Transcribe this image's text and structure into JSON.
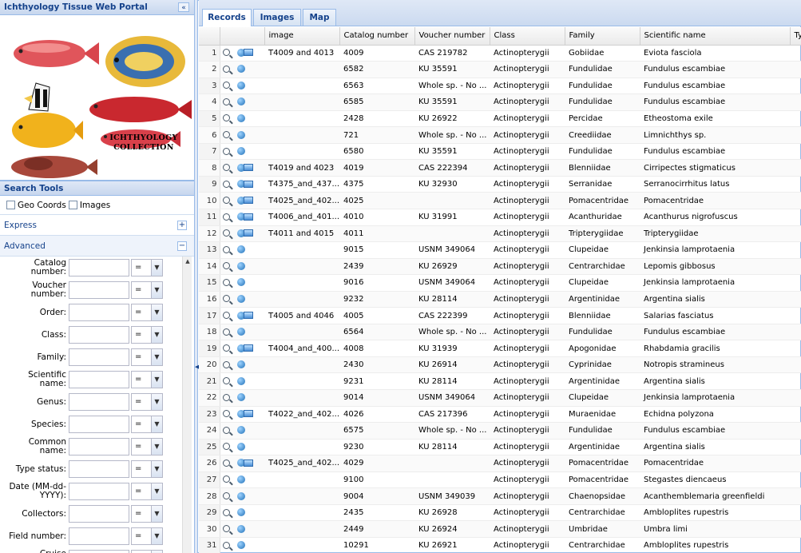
{
  "portal": {
    "title": "Ichthyology Tissue Web Portal",
    "collapse_icon": "«"
  },
  "collage": {
    "label_line1": "ICHTHYOLOGY",
    "label_line2": "COLLECTION"
  },
  "search_tools": {
    "title": "Search Tools",
    "checkboxes": [
      "Geo Coords",
      "Images"
    ],
    "express_label": "Express",
    "advanced_label": "Advanced",
    "express_toggle": "+",
    "advanced_toggle": "−",
    "fields": [
      {
        "label": "Catalog number:",
        "op": "="
      },
      {
        "label": "Voucher number:",
        "op": "="
      },
      {
        "label": "Order:",
        "op": "="
      },
      {
        "label": "Class:",
        "op": "="
      },
      {
        "label": "Family:",
        "op": "="
      },
      {
        "label": "Scientific name:",
        "op": "="
      },
      {
        "label": "Genus:",
        "op": "="
      },
      {
        "label": "Species:",
        "op": "="
      },
      {
        "label": "Common name:",
        "op": "="
      },
      {
        "label": "Type status:",
        "op": "="
      },
      {
        "label": "Date (MM-dd-YYYY):",
        "op": "="
      },
      {
        "label": "Collectors:",
        "op": "="
      },
      {
        "label": "Field number:",
        "op": "="
      },
      {
        "label": "Cruise information:",
        "op": "="
      }
    ]
  },
  "tabs": [
    "Records",
    "Images",
    "Map"
  ],
  "grid": {
    "columns": [
      "image",
      "Catalog number",
      "Voucher number",
      "Class",
      "Family",
      "Scientific name",
      "Typ"
    ],
    "rows": [
      {
        "n": "1",
        "img": true,
        "image": "T4009 and 4013",
        "cat": "4009",
        "vou": "CAS 219782",
        "cls": "Actinopterygii",
        "fam": "Gobiidae",
        "sci": "Eviota fasciola"
      },
      {
        "n": "2",
        "img": false,
        "image": "",
        "cat": "6582",
        "vou": "KU 35591",
        "cls": "Actinopterygii",
        "fam": "Fundulidae",
        "sci": "Fundulus escambiae"
      },
      {
        "n": "3",
        "img": false,
        "image": "",
        "cat": "6563",
        "vou": "Whole sp. - No ...",
        "cls": "Actinopterygii",
        "fam": "Fundulidae",
        "sci": "Fundulus escambiae"
      },
      {
        "n": "4",
        "img": false,
        "image": "",
        "cat": "6585",
        "vou": "KU 35591",
        "cls": "Actinopterygii",
        "fam": "Fundulidae",
        "sci": "Fundulus escambiae"
      },
      {
        "n": "5",
        "img": false,
        "image": "",
        "cat": "2428",
        "vou": "KU 26922",
        "cls": "Actinopterygii",
        "fam": "Percidae",
        "sci": "Etheostoma exile"
      },
      {
        "n": "6",
        "img": false,
        "image": "",
        "cat": "721",
        "vou": "Whole sp. - No ...",
        "cls": "Actinopterygii",
        "fam": "Creediidae",
        "sci": "Limnichthys sp."
      },
      {
        "n": "7",
        "img": false,
        "image": "",
        "cat": "6580",
        "vou": "KU 35591",
        "cls": "Actinopterygii",
        "fam": "Fundulidae",
        "sci": "Fundulus escambiae"
      },
      {
        "n": "8",
        "img": true,
        "image": "T4019 and 4023",
        "cat": "4019",
        "vou": "CAS 222394",
        "cls": "Actinopterygii",
        "fam": "Blenniidae",
        "sci": "Cirripectes stigmaticus"
      },
      {
        "n": "9",
        "img": true,
        "image": "T4375_and_437...",
        "cat": "4375",
        "vou": "KU 32930",
        "cls": "Actinopterygii",
        "fam": "Serranidae",
        "sci": "Serranocirrhitus latus"
      },
      {
        "n": "10",
        "img": true,
        "image": "T4025_and_402...",
        "cat": "4025",
        "vou": "",
        "cls": "Actinopterygii",
        "fam": "Pomacentridae",
        "sci": "Pomacentridae"
      },
      {
        "n": "11",
        "img": true,
        "image": "T4006_and_401...",
        "cat": "4010",
        "vou": "KU 31991",
        "cls": "Actinopterygii",
        "fam": "Acanthuridae",
        "sci": "Acanthurus nigrofuscus"
      },
      {
        "n": "12",
        "img": true,
        "image": "T4011 and 4015",
        "cat": "4011",
        "vou": "",
        "cls": "Actinopterygii",
        "fam": "Tripterygiidae",
        "sci": "Tripterygiidae"
      },
      {
        "n": "13",
        "img": false,
        "image": "",
        "cat": "9015",
        "vou": "USNM 349064",
        "cls": "Actinopterygii",
        "fam": "Clupeidae",
        "sci": "Jenkinsia lamprotaenia"
      },
      {
        "n": "14",
        "img": false,
        "image": "",
        "cat": "2439",
        "vou": "KU 26929",
        "cls": "Actinopterygii",
        "fam": "Centrarchidae",
        "sci": "Lepomis gibbosus"
      },
      {
        "n": "15",
        "img": false,
        "image": "",
        "cat": "9016",
        "vou": "USNM 349064",
        "cls": "Actinopterygii",
        "fam": "Clupeidae",
        "sci": "Jenkinsia lamprotaenia"
      },
      {
        "n": "16",
        "img": false,
        "image": "",
        "cat": "9232",
        "vou": "KU 28114",
        "cls": "Actinopterygii",
        "fam": "Argentinidae",
        "sci": "Argentina sialis"
      },
      {
        "n": "17",
        "img": true,
        "image": "T4005 and 4046",
        "cat": "4005",
        "vou": "CAS 222399",
        "cls": "Actinopterygii",
        "fam": "Blenniidae",
        "sci": "Salarias fasciatus"
      },
      {
        "n": "18",
        "img": false,
        "image": "",
        "cat": "6564",
        "vou": "Whole sp. - No ...",
        "cls": "Actinopterygii",
        "fam": "Fundulidae",
        "sci": "Fundulus escambiae"
      },
      {
        "n": "19",
        "img": true,
        "image": "T4004_and_400...",
        "cat": "4008",
        "vou": "KU 31939",
        "cls": "Actinopterygii",
        "fam": "Apogonidae",
        "sci": "Rhabdamia gracilis"
      },
      {
        "n": "20",
        "img": false,
        "image": "",
        "cat": "2430",
        "vou": "KU 26914",
        "cls": "Actinopterygii",
        "fam": "Cyprinidae",
        "sci": "Notropis stramineus"
      },
      {
        "n": "21",
        "img": false,
        "image": "",
        "cat": "9231",
        "vou": "KU 28114",
        "cls": "Actinopterygii",
        "fam": "Argentinidae",
        "sci": "Argentina sialis"
      },
      {
        "n": "22",
        "img": false,
        "image": "",
        "cat": "9014",
        "vou": "USNM 349064",
        "cls": "Actinopterygii",
        "fam": "Clupeidae",
        "sci": "Jenkinsia lamprotaenia"
      },
      {
        "n": "23",
        "img": true,
        "image": "T4022_and_402...",
        "cat": "4026",
        "vou": "CAS 217396",
        "cls": "Actinopterygii",
        "fam": "Muraenidae",
        "sci": "Echidna polyzona"
      },
      {
        "n": "24",
        "img": false,
        "image": "",
        "cat": "6575",
        "vou": "Whole sp. - No ...",
        "cls": "Actinopterygii",
        "fam": "Fundulidae",
        "sci": "Fundulus escambiae"
      },
      {
        "n": "25",
        "img": false,
        "image": "",
        "cat": "9230",
        "vou": "KU 28114",
        "cls": "Actinopterygii",
        "fam": "Argentinidae",
        "sci": "Argentina sialis"
      },
      {
        "n": "26",
        "img": true,
        "image": "T4025_and_402...",
        "cat": "4029",
        "vou": "",
        "cls": "Actinopterygii",
        "fam": "Pomacentridae",
        "sci": "Pomacentridae"
      },
      {
        "n": "27",
        "img": false,
        "image": "",
        "cat": "9100",
        "vou": "",
        "cls": "Actinopterygii",
        "fam": "Pomacentridae",
        "sci": "Stegastes diencaeus"
      },
      {
        "n": "28",
        "img": false,
        "image": "",
        "cat": "9004",
        "vou": "USNM 349039",
        "cls": "Actinopterygii",
        "fam": "Chaenopsidae",
        "sci": "Acanthemblemaria greenfieldi"
      },
      {
        "n": "29",
        "img": false,
        "image": "",
        "cat": "2435",
        "vou": "KU 26928",
        "cls": "Actinopterygii",
        "fam": "Centrarchidae",
        "sci": "Ambloplites rupestris"
      },
      {
        "n": "30",
        "img": false,
        "image": "",
        "cat": "2449",
        "vou": "KU 26924",
        "cls": "Actinopterygii",
        "fam": "Umbridae",
        "sci": "Umbra limi"
      },
      {
        "n": "31",
        "img": false,
        "image": "",
        "cat": "10291",
        "vou": "KU 26921",
        "cls": "Actinopterygii",
        "fam": "Centrarchidae",
        "sci": "Ambloplites rupestris"
      }
    ]
  },
  "icons": {
    "detail": "magnifier-icon",
    "record": "record-icon",
    "image": "image-icon"
  }
}
